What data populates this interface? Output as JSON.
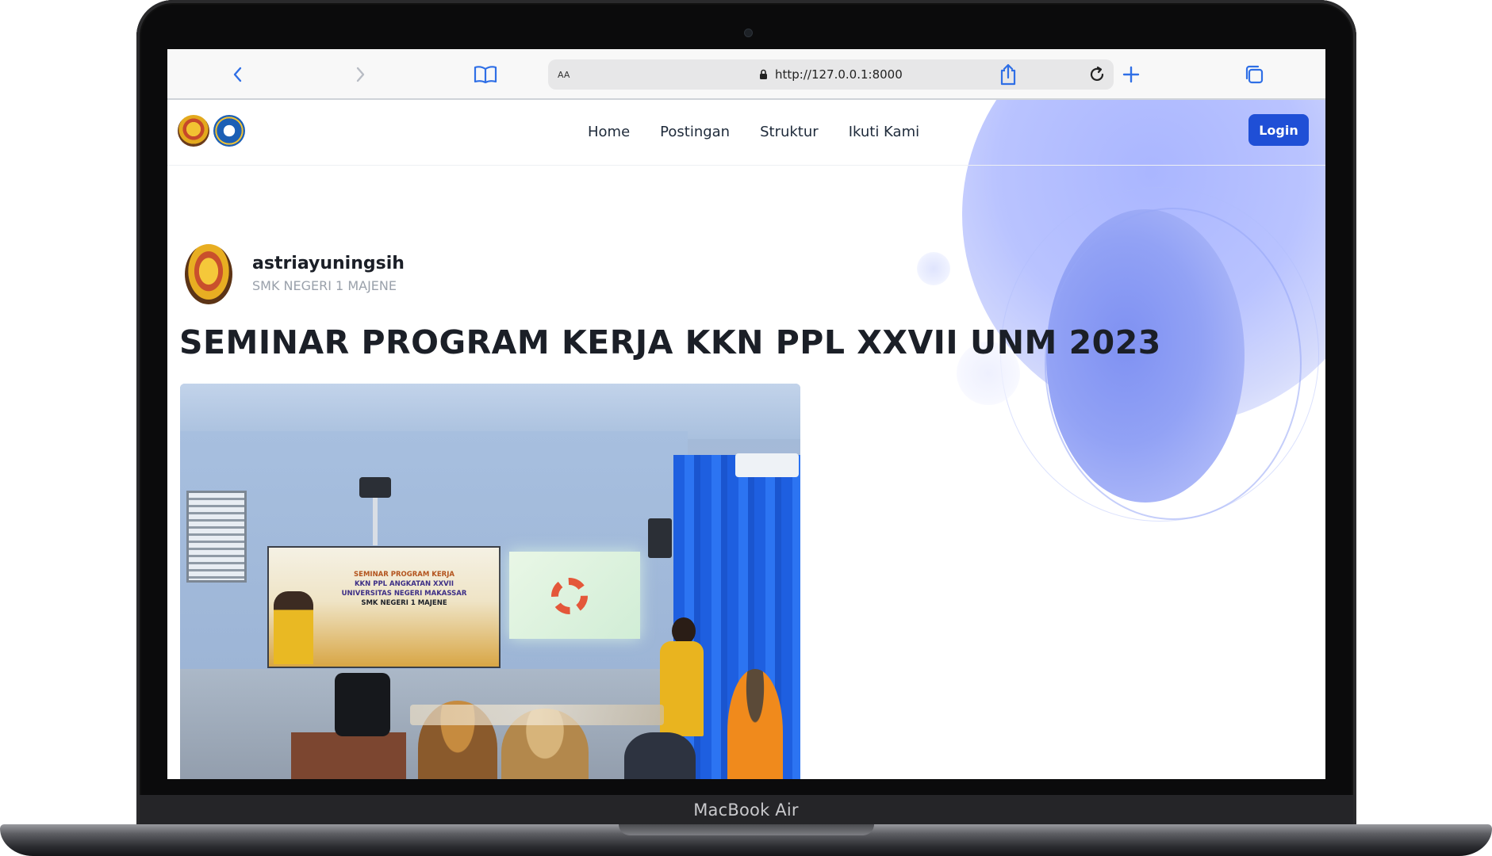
{
  "device": {
    "label": "MacBook Air"
  },
  "browser": {
    "address_bar": {
      "text_size_label": "AA",
      "url": "http://127.0.0.1:8000"
    },
    "icons": {
      "back": "chevron-left-icon",
      "forward": "chevron-right-icon",
      "bookmarks": "book-icon",
      "lock": "lock-icon",
      "reload": "reload-icon",
      "share": "share-icon",
      "new_tab": "plus-icon",
      "tabs": "tabs-icon"
    },
    "accent_color": "#2f6fe6"
  },
  "site": {
    "nav": {
      "links": [
        "Home",
        "Postingan",
        "Struktur",
        "Ikuti Kami"
      ],
      "login_label": "Login"
    },
    "brand_color": "#1f4fd6",
    "post": {
      "author": "astriayuningsih",
      "school": "SMK NEGERI 1 MAJENE",
      "title": "SEMINAR PROGRAM KERJA KKN PPL XXVII UNM 2023",
      "image": {
        "banner_lines": [
          "SEMINAR PROGRAM KERJA",
          "KKN PPL ANGKATAN XXVII",
          "UNIVERSITAS NEGERI MAKASSAR",
          "SMK NEGERI 1 MAJENE"
        ]
      }
    }
  }
}
